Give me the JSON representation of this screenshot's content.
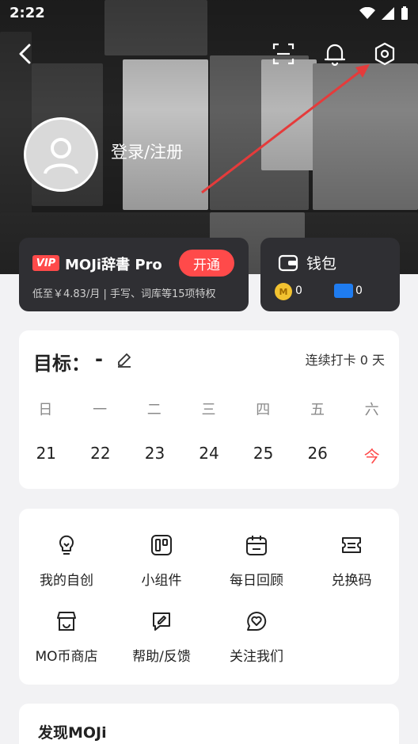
{
  "status_bar": {
    "time": "2:22"
  },
  "profile": {
    "login_label": "登录/注册"
  },
  "vip": {
    "badge": "VIP",
    "title": "MOJi辞書 Pro",
    "button": "开通",
    "subtitle": "低至￥4.83/月 | 手写、词库等15项特权"
  },
  "wallet": {
    "title": "钱包",
    "coin_icon_text": "M",
    "coin_count": "0",
    "ticket_count": "0"
  },
  "goal": {
    "title": "目标：",
    "value": "-",
    "streak": "连续打卡 0 天",
    "weekdays": [
      "日",
      "一",
      "二",
      "三",
      "四",
      "五",
      "六"
    ],
    "dates": [
      "21",
      "22",
      "23",
      "24",
      "25",
      "26",
      "今"
    ]
  },
  "features": [
    {
      "label": "我的自创",
      "icon": "lightbulb-icon"
    },
    {
      "label": "小组件",
      "icon": "widget-icon"
    },
    {
      "label": "每日回顾",
      "icon": "calendar-icon"
    },
    {
      "label": "兑换码",
      "icon": "ticket-icon"
    },
    {
      "label": "MO币商店",
      "icon": "shop-icon"
    },
    {
      "label": "帮助/反馈",
      "icon": "feedback-icon"
    },
    {
      "label": "关注我们",
      "icon": "heart-chat-icon"
    }
  ],
  "discover": {
    "title": "发现MOJi"
  },
  "colors": {
    "accent": "#ff4a4a",
    "card_dark": "#2f2f33",
    "background": "#f2f2f4"
  }
}
